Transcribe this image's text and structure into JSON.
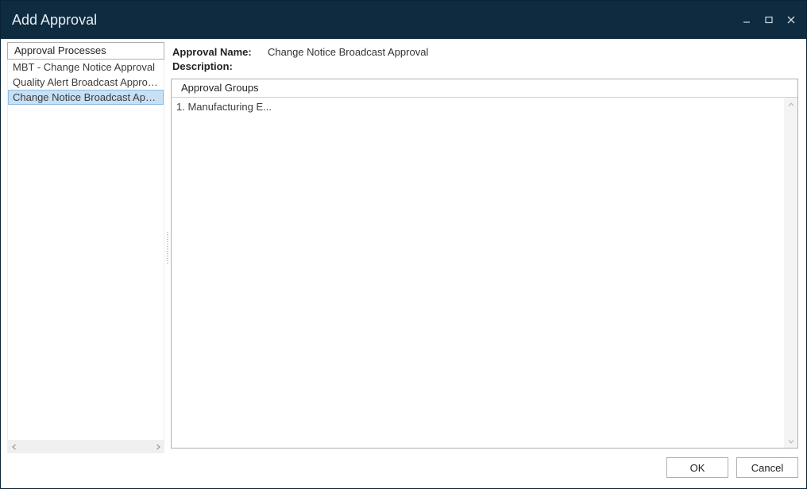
{
  "window": {
    "title": "Add Approval"
  },
  "left": {
    "header": "Approval Processes",
    "items": [
      {
        "label": "MBT - Change Notice Approval",
        "selected": false
      },
      {
        "label": "Quality Alert Broadcast Approval",
        "selected": false
      },
      {
        "label": "Change Notice Broadcast Approval",
        "selected": true
      }
    ]
  },
  "details": {
    "name_label": "Approval Name:",
    "name_value": "Change Notice Broadcast Approval",
    "description_label": "Description:",
    "description_value": ""
  },
  "groups": {
    "header": "Approval Groups",
    "items": [
      {
        "label": "1. Manufacturing E..."
      }
    ]
  },
  "footer": {
    "ok": "OK",
    "cancel": "Cancel"
  }
}
